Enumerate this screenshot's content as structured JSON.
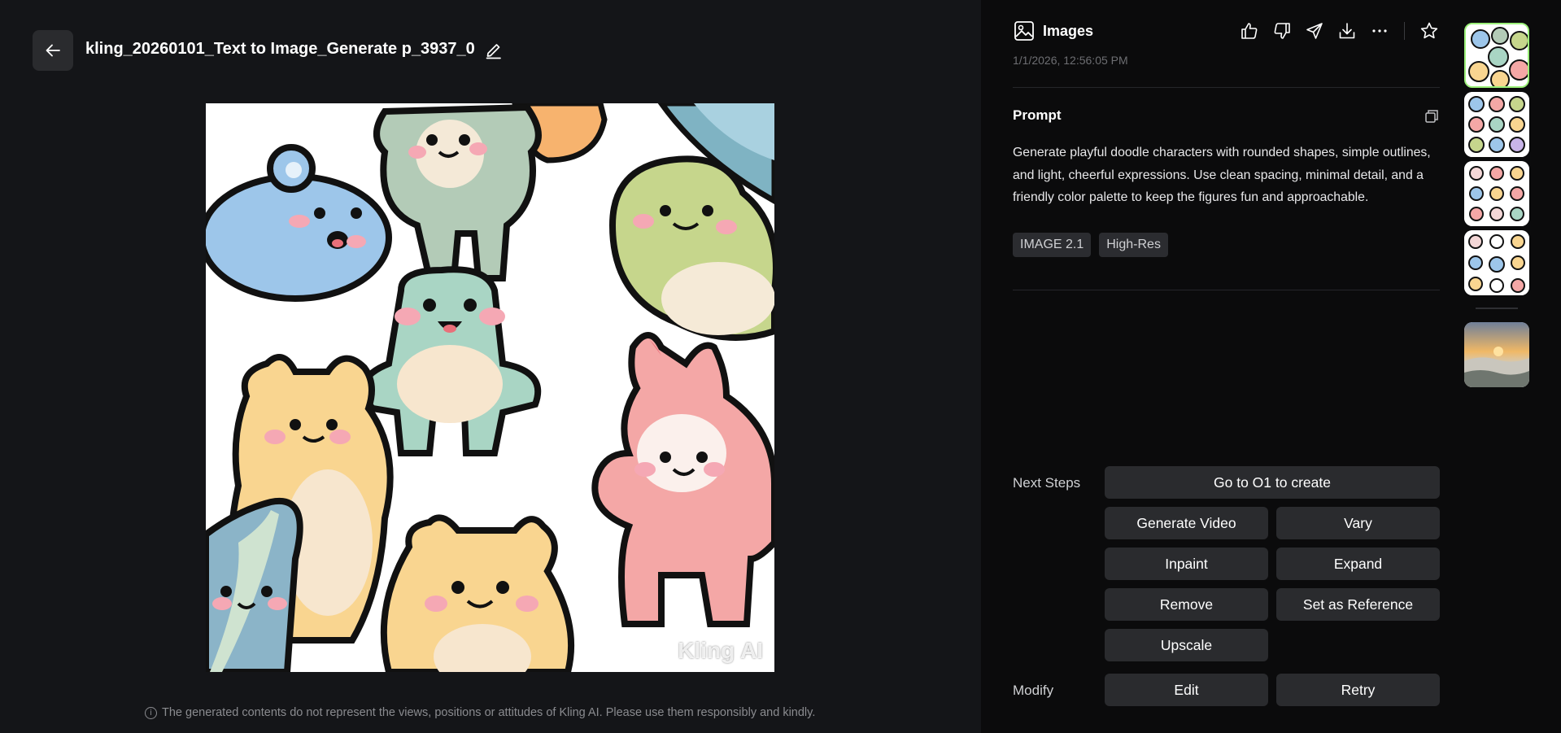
{
  "header": {
    "title": "kling_20260101_Text to Image_Generate p_3937_0"
  },
  "disclaimer": "The generated contents do not represent the views, positions or attitudes of Kling AI. Please use them responsibly and kindly.",
  "watermark": "Kling AI",
  "panel": {
    "title": "Images",
    "timestamp": "1/1/2026, 12:56:05 PM",
    "prompt_label": "Prompt",
    "prompt_text": "Generate playful doodle characters with rounded shapes, simple outlines, and light, cheerful expressions. Use clean spacing, minimal detail, and a friendly color palette to keep the figures fun and approachable.",
    "tags": [
      "IMAGE 2.1",
      "High-Res"
    ],
    "actions": [
      "thumbs-up-icon",
      "thumbs-down-icon",
      "send-icon",
      "download-icon",
      "more-icon",
      "star-icon"
    ]
  },
  "next_steps": {
    "label": "Next Steps",
    "go_o1": "Go to O1 to create",
    "generate_video": "Generate Video",
    "vary": "Vary",
    "inpaint": "Inpaint",
    "expand": "Expand",
    "remove": "Remove",
    "set_reference": "Set as Reference",
    "upscale": "Upscale"
  },
  "modify": {
    "label": "Modify",
    "edit": "Edit",
    "retry": "Retry"
  },
  "colors": {
    "accent_thumb_border": "#9cf07a",
    "button_bg": "#2a2b2e",
    "panel_bg": "#0b0b0c",
    "page_bg": "#141518"
  }
}
